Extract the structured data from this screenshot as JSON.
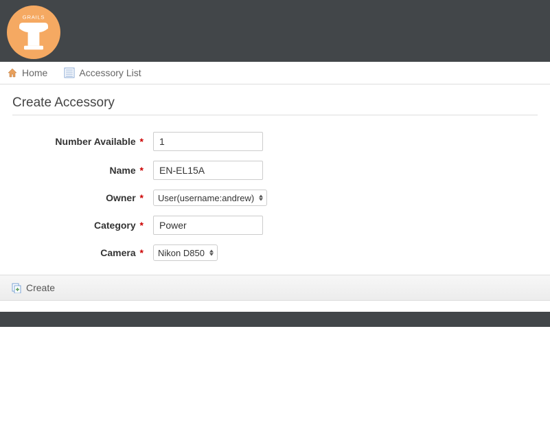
{
  "brand": {
    "name": "GRAILS"
  },
  "nav": {
    "home": "Home",
    "list": "Accessory List"
  },
  "page": {
    "title": "Create Accessory"
  },
  "form": {
    "numberAvailable": {
      "label": "Number Available",
      "value": "1",
      "required": true
    },
    "name": {
      "label": "Name",
      "value": "EN-EL15A",
      "required": true
    },
    "owner": {
      "label": "Owner",
      "selected": "User(username:andrew)",
      "required": true
    },
    "category": {
      "label": "Category",
      "value": "Power",
      "required": true
    },
    "camera": {
      "label": "Camera",
      "selected": "Nikon D850",
      "required": true
    }
  },
  "buttons": {
    "create": "Create"
  },
  "requiredMark": "*"
}
